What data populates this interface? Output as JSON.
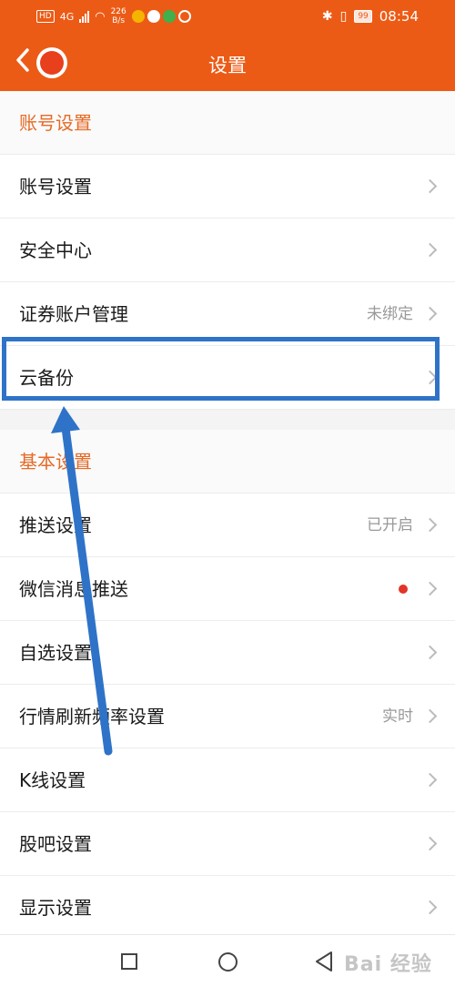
{
  "status_bar": {
    "hd": "HD",
    "net": "4G",
    "speed_value": "226",
    "speed_unit": "B/s",
    "battery": "99",
    "time": "08:54"
  },
  "nav": {
    "title": "设置"
  },
  "sections": [
    {
      "header": "账号设置",
      "items": [
        {
          "label": "账号设置",
          "value": ""
        },
        {
          "label": "安全中心",
          "value": ""
        },
        {
          "label": "证券账户管理",
          "value": "未绑定"
        },
        {
          "label": "云备份",
          "value": ""
        }
      ]
    },
    {
      "header": "基本设置",
      "items": [
        {
          "label": "推送设置",
          "value": "已开启"
        },
        {
          "label": "微信消息推送",
          "value": "",
          "badge": "red-dot"
        },
        {
          "label": "自选设置",
          "value": ""
        },
        {
          "label": "行情刷新频率设置",
          "value": "实时"
        },
        {
          "label": "K线设置",
          "value": ""
        },
        {
          "label": "股吧设置",
          "value": ""
        },
        {
          "label": "显示设置",
          "value": ""
        }
      ]
    }
  ],
  "annotation": {
    "highlight_color": "#2f73c8",
    "target": "云备份"
  },
  "watermark": "Bai 经验",
  "colors": {
    "brand": "#ec5b16",
    "section_header": "#e56a26",
    "badge": "#e3342a"
  }
}
